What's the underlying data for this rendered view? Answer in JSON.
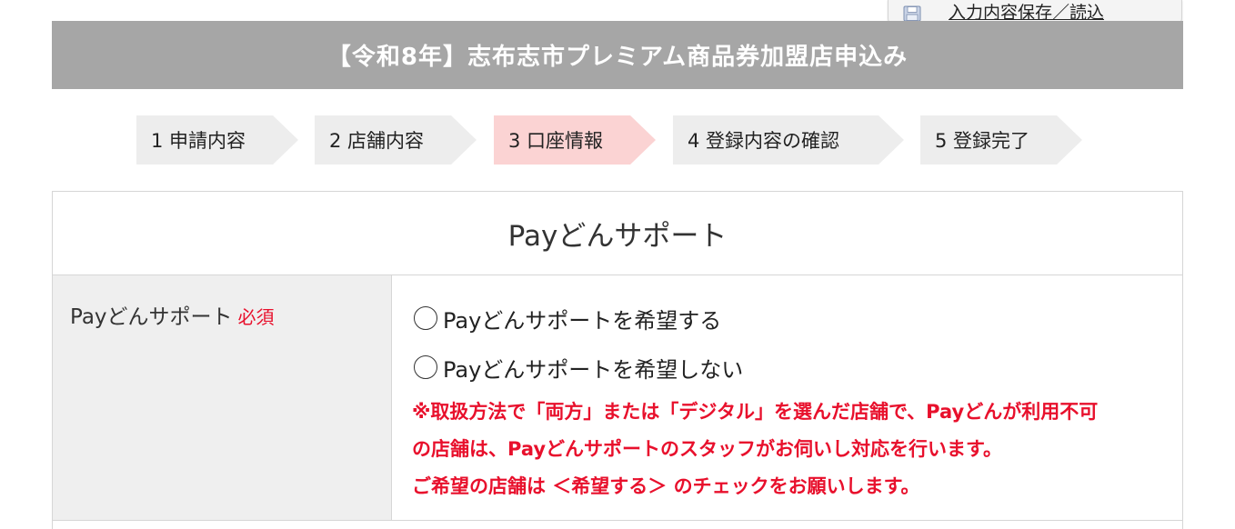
{
  "save_tab": {
    "icon": "floppy-disk-icon",
    "label": "入力内容保存／読込"
  },
  "header": {
    "title": "【令和8年】志布志市プレミアム商品券加盟店申込み",
    "background": "#a6a6a6"
  },
  "steps": [
    {
      "label": "1 申請内容",
      "active": false
    },
    {
      "label": "2 店舗内容",
      "active": false
    },
    {
      "label": "3 口座情報",
      "active": true
    },
    {
      "label": "4 登録内容の確認",
      "active": false
    },
    {
      "label": "5 登録完了",
      "active": false
    }
  ],
  "section": {
    "title": "Payどんサポート"
  },
  "field": {
    "label": "Payどんサポート",
    "required_label": "必須",
    "options": [
      {
        "label": "Payどんサポートを希望する",
        "selected": false
      },
      {
        "label": "Payどんサポートを希望しない",
        "selected": false
      }
    ],
    "note_lines": [
      "※取扱方法で「両方」または「デジタル」を選んだ店舗で、Payどんが利用不可",
      "の店舗は、Payどんサポートのスタッフがお伺いし対応を行います。",
      "ご希望の店舗は ＜希望する＞ のチェックをお願いします。"
    ]
  },
  "colors": {
    "required": "#e8102c",
    "active_step": "#fbd3d3",
    "inactive_step": "#ededed"
  }
}
